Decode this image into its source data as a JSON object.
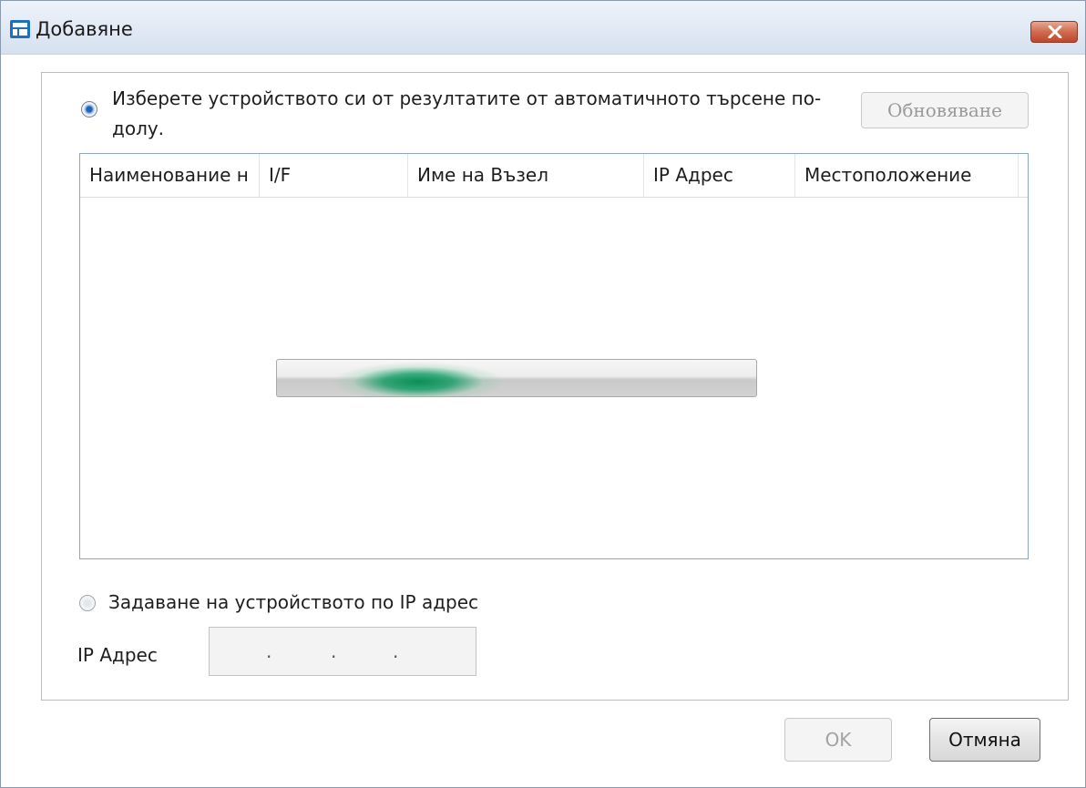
{
  "window": {
    "title": "Добавяне",
    "app_icon": "printer-icon",
    "close_icon": "close-icon"
  },
  "auto_search": {
    "label_line1": "Изберете устройството си от резултатите от автоматичното търсене по-",
    "label_line2": "долу.",
    "selected": true,
    "refresh_label": "Обновяване",
    "refresh_enabled": false
  },
  "device_list": {
    "columns": [
      "Наименование н",
      "I/F",
      "Име на Възел",
      "IP Адрес",
      "Местоположение"
    ],
    "rows": [],
    "searching": true
  },
  "manual": {
    "label": "Задаване на устройството по IP адрес",
    "selected": false,
    "ip_label": "IP Адрес",
    "ip_separator": "."
  },
  "buttons": {
    "ok": "OK",
    "cancel": "Отмяна"
  },
  "colors": {
    "progress": "#00965a",
    "titlebar": "#dfe8f4",
    "close": "#c75a3e"
  }
}
